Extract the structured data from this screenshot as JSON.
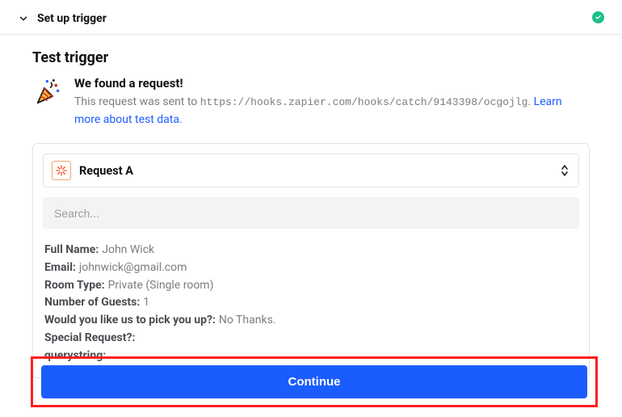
{
  "header": {
    "title": "Set up trigger"
  },
  "section": {
    "title": "Test trigger",
    "found_title": "We found a request!",
    "found_prefix": "This request was sent to ",
    "found_url": "https://hooks.zapier.com/hooks/catch/9143398/ocgojlg",
    "found_sep": ". ",
    "found_link": "Learn more about test data",
    "found_period": "."
  },
  "selector": {
    "label": "Request A"
  },
  "search": {
    "placeholder": "Search..."
  },
  "records": [
    {
      "label": "Full Name:",
      "value": "John Wick"
    },
    {
      "label": "Email:",
      "value": "johnwick@gmail.com"
    },
    {
      "label": "Room Type:",
      "value": "Private (Single room)"
    },
    {
      "label": "Number of Guests:",
      "value": "1"
    },
    {
      "label": "Would you like us to pick you up?:",
      "value": "No Thanks."
    },
    {
      "label": "Special Request?:",
      "value": ""
    },
    {
      "label": "querystring:",
      "value": ""
    }
  ],
  "buttons": {
    "continue": "Continue"
  },
  "colors": {
    "primary": "#1b5cff",
    "highlight_border": "#ff1f1f",
    "success": "#1bbf8a",
    "zap_orange": "#ff4f1f"
  }
}
